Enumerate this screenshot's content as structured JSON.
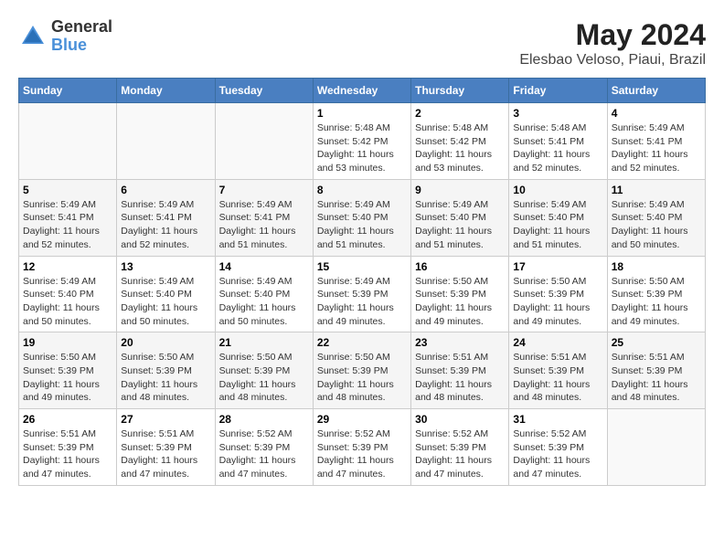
{
  "logo": {
    "text_general": "General",
    "text_blue": "Blue"
  },
  "title": "May 2024",
  "subtitle": "Elesbao Veloso, Piaui, Brazil",
  "days_of_week": [
    "Sunday",
    "Monday",
    "Tuesday",
    "Wednesday",
    "Thursday",
    "Friday",
    "Saturday"
  ],
  "weeks": [
    [
      {
        "day": "",
        "info": ""
      },
      {
        "day": "",
        "info": ""
      },
      {
        "day": "",
        "info": ""
      },
      {
        "day": "1",
        "info": "Sunrise: 5:48 AM\nSunset: 5:42 PM\nDaylight: 11 hours\nand 53 minutes."
      },
      {
        "day": "2",
        "info": "Sunrise: 5:48 AM\nSunset: 5:42 PM\nDaylight: 11 hours\nand 53 minutes."
      },
      {
        "day": "3",
        "info": "Sunrise: 5:48 AM\nSunset: 5:41 PM\nDaylight: 11 hours\nand 52 minutes."
      },
      {
        "day": "4",
        "info": "Sunrise: 5:49 AM\nSunset: 5:41 PM\nDaylight: 11 hours\nand 52 minutes."
      }
    ],
    [
      {
        "day": "5",
        "info": "Sunrise: 5:49 AM\nSunset: 5:41 PM\nDaylight: 11 hours\nand 52 minutes."
      },
      {
        "day": "6",
        "info": "Sunrise: 5:49 AM\nSunset: 5:41 PM\nDaylight: 11 hours\nand 52 minutes."
      },
      {
        "day": "7",
        "info": "Sunrise: 5:49 AM\nSunset: 5:41 PM\nDaylight: 11 hours\nand 51 minutes."
      },
      {
        "day": "8",
        "info": "Sunrise: 5:49 AM\nSunset: 5:40 PM\nDaylight: 11 hours\nand 51 minutes."
      },
      {
        "day": "9",
        "info": "Sunrise: 5:49 AM\nSunset: 5:40 PM\nDaylight: 11 hours\nand 51 minutes."
      },
      {
        "day": "10",
        "info": "Sunrise: 5:49 AM\nSunset: 5:40 PM\nDaylight: 11 hours\nand 51 minutes."
      },
      {
        "day": "11",
        "info": "Sunrise: 5:49 AM\nSunset: 5:40 PM\nDaylight: 11 hours\nand 50 minutes."
      }
    ],
    [
      {
        "day": "12",
        "info": "Sunrise: 5:49 AM\nSunset: 5:40 PM\nDaylight: 11 hours\nand 50 minutes."
      },
      {
        "day": "13",
        "info": "Sunrise: 5:49 AM\nSunset: 5:40 PM\nDaylight: 11 hours\nand 50 minutes."
      },
      {
        "day": "14",
        "info": "Sunrise: 5:49 AM\nSunset: 5:40 PM\nDaylight: 11 hours\nand 50 minutes."
      },
      {
        "day": "15",
        "info": "Sunrise: 5:49 AM\nSunset: 5:39 PM\nDaylight: 11 hours\nand 49 minutes."
      },
      {
        "day": "16",
        "info": "Sunrise: 5:50 AM\nSunset: 5:39 PM\nDaylight: 11 hours\nand 49 minutes."
      },
      {
        "day": "17",
        "info": "Sunrise: 5:50 AM\nSunset: 5:39 PM\nDaylight: 11 hours\nand 49 minutes."
      },
      {
        "day": "18",
        "info": "Sunrise: 5:50 AM\nSunset: 5:39 PM\nDaylight: 11 hours\nand 49 minutes."
      }
    ],
    [
      {
        "day": "19",
        "info": "Sunrise: 5:50 AM\nSunset: 5:39 PM\nDaylight: 11 hours\nand 49 minutes."
      },
      {
        "day": "20",
        "info": "Sunrise: 5:50 AM\nSunset: 5:39 PM\nDaylight: 11 hours\nand 48 minutes."
      },
      {
        "day": "21",
        "info": "Sunrise: 5:50 AM\nSunset: 5:39 PM\nDaylight: 11 hours\nand 48 minutes."
      },
      {
        "day": "22",
        "info": "Sunrise: 5:50 AM\nSunset: 5:39 PM\nDaylight: 11 hours\nand 48 minutes."
      },
      {
        "day": "23",
        "info": "Sunrise: 5:51 AM\nSunset: 5:39 PM\nDaylight: 11 hours\nand 48 minutes."
      },
      {
        "day": "24",
        "info": "Sunrise: 5:51 AM\nSunset: 5:39 PM\nDaylight: 11 hours\nand 48 minutes."
      },
      {
        "day": "25",
        "info": "Sunrise: 5:51 AM\nSunset: 5:39 PM\nDaylight: 11 hours\nand 48 minutes."
      }
    ],
    [
      {
        "day": "26",
        "info": "Sunrise: 5:51 AM\nSunset: 5:39 PM\nDaylight: 11 hours\nand 47 minutes."
      },
      {
        "day": "27",
        "info": "Sunrise: 5:51 AM\nSunset: 5:39 PM\nDaylight: 11 hours\nand 47 minutes."
      },
      {
        "day": "28",
        "info": "Sunrise: 5:52 AM\nSunset: 5:39 PM\nDaylight: 11 hours\nand 47 minutes."
      },
      {
        "day": "29",
        "info": "Sunrise: 5:52 AM\nSunset: 5:39 PM\nDaylight: 11 hours\nand 47 minutes."
      },
      {
        "day": "30",
        "info": "Sunrise: 5:52 AM\nSunset: 5:39 PM\nDaylight: 11 hours\nand 47 minutes."
      },
      {
        "day": "31",
        "info": "Sunrise: 5:52 AM\nSunset: 5:39 PM\nDaylight: 11 hours\nand 47 minutes."
      },
      {
        "day": "",
        "info": ""
      }
    ]
  ]
}
